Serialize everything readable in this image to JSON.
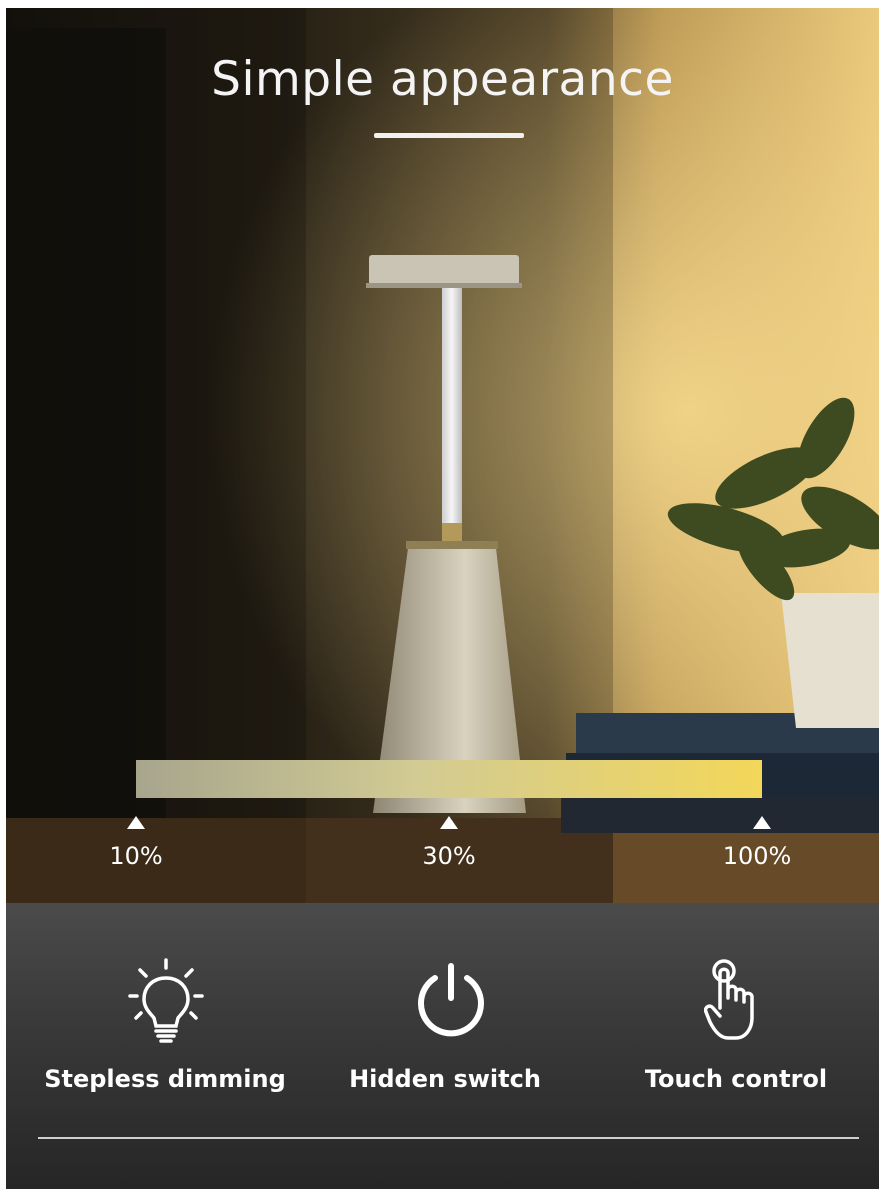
{
  "title": "Simple appearance",
  "dimming": {
    "levels": [
      {
        "label": "10%",
        "value": 10
      },
      {
        "label": "30%",
        "value": 30
      },
      {
        "label": "100%",
        "value": 100
      }
    ]
  },
  "features": [
    {
      "label": "Stepless dimming",
      "icon": "bulb-icon"
    },
    {
      "label": "Hidden switch",
      "icon": "power-icon"
    },
    {
      "label": "Touch control",
      "icon": "touch-hand-icon"
    }
  ],
  "colors": {
    "bar_start": "#a7a58d",
    "bar_end": "#f3d75a",
    "text": "#ffffff",
    "panel": "#3a3a3a"
  }
}
